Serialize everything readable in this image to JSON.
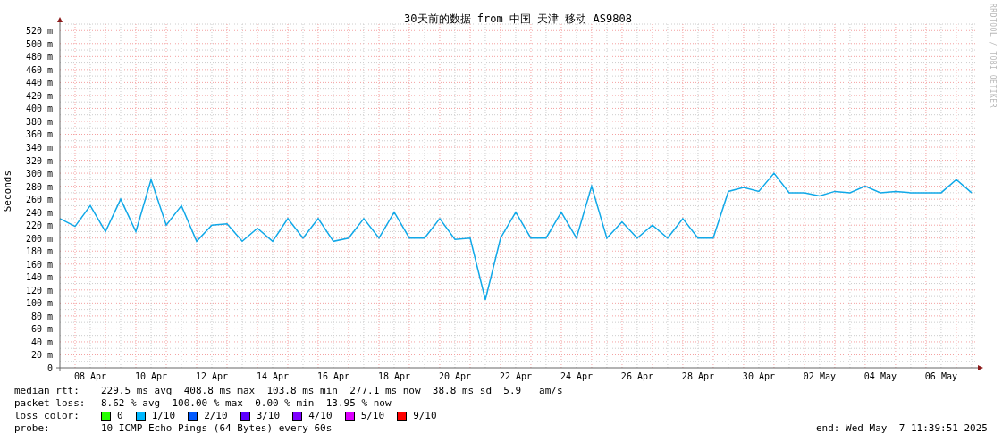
{
  "graph": {
    "credit": "RRDTOOL / TOBI OETIKER",
    "chart_data": {
      "type": "line",
      "title": "30天前的数据 from 中国 天津 移动 AS9808",
      "ylabel": "Seconds",
      "ylim": [
        0,
        530
      ],
      "grid": true,
      "yticks": [
        {
          "value": 0,
          "label": "0"
        },
        {
          "value": 20,
          "label": "20 m"
        },
        {
          "value": 40,
          "label": "40 m"
        },
        {
          "value": 60,
          "label": "60 m"
        },
        {
          "value": 80,
          "label": "80 m"
        },
        {
          "value": 100,
          "label": "100 m"
        },
        {
          "value": 120,
          "label": "120 m"
        },
        {
          "value": 140,
          "label": "140 m"
        },
        {
          "value": 160,
          "label": "160 m"
        },
        {
          "value": 180,
          "label": "180 m"
        },
        {
          "value": 200,
          "label": "200 m"
        },
        {
          "value": 220,
          "label": "220 m"
        },
        {
          "value": 240,
          "label": "240 m"
        },
        {
          "value": 260,
          "label": "260 m"
        },
        {
          "value": 280,
          "label": "280 m"
        },
        {
          "value": 300,
          "label": "300 m"
        },
        {
          "value": 320,
          "label": "320 m"
        },
        {
          "value": 340,
          "label": "340 m"
        },
        {
          "value": 360,
          "label": "360 m"
        },
        {
          "value": 380,
          "label": "380 m"
        },
        {
          "value": 400,
          "label": "400 m"
        },
        {
          "value": 420,
          "label": "420 m"
        },
        {
          "value": 440,
          "label": "440 m"
        },
        {
          "value": 460,
          "label": "460 m"
        },
        {
          "value": 480,
          "label": "480 m"
        },
        {
          "value": 500,
          "label": "500 m"
        },
        {
          "value": 520,
          "label": "520 m"
        }
      ],
      "categories": [
        null,
        null,
        "08 Apr",
        null,
        null,
        null,
        "10 Apr",
        null,
        null,
        null,
        "12 Apr",
        null,
        null,
        null,
        "14 Apr",
        null,
        null,
        null,
        "16 Apr",
        null,
        null,
        null,
        "18 Apr",
        null,
        null,
        null,
        "20 Apr",
        null,
        null,
        null,
        "22 Apr",
        null,
        null,
        null,
        "24 Apr",
        null,
        null,
        null,
        "26 Apr",
        null,
        null,
        null,
        "28 Apr",
        null,
        null,
        null,
        "30 Apr",
        null,
        null,
        null,
        "02 May",
        null,
        null,
        null,
        "04 May",
        null,
        null,
        null,
        "06 May",
        null,
        null
      ],
      "series": [
        {
          "color": "#10a8e8",
          "values": [
            230,
            218,
            250,
            210,
            260,
            210,
            290,
            220,
            250,
            195,
            220,
            222,
            195,
            215,
            195,
            230,
            200,
            230,
            195,
            200,
            230,
            200,
            240,
            200,
            200,
            230,
            198,
            200,
            105,
            200,
            240,
            200,
            200,
            240,
            200,
            280,
            200,
            225,
            200,
            220,
            200,
            230,
            200,
            200,
            272,
            278,
            272,
            300,
            270,
            270,
            265,
            272,
            270,
            280,
            270,
            272,
            270,
            270,
            270,
            290,
            270
          ]
        }
      ]
    }
  },
  "legend": {
    "median_rtt": {
      "label": "median rtt:",
      "text": "229.5 ms avg  408.8 ms max  103.8 ms min  277.1 ms now  38.8 ms sd  5.9   am/s"
    },
    "packet_loss": {
      "label": "packet loss:",
      "text": "8.62 % avg  100.00 % max  0.00 % min  13.95 % now"
    },
    "loss_color": {
      "label": "loss color:",
      "items": [
        {
          "label": "0",
          "color": "#26ff00"
        },
        {
          "label": "1/10",
          "color": "#00b8ff"
        },
        {
          "label": "2/10",
          "color": "#0059ff"
        },
        {
          "label": "3/10",
          "color": "#5e00ff"
        },
        {
          "label": "4/10",
          "color": "#7e00ff"
        },
        {
          "label": "5/10",
          "color": "#dd00ff"
        },
        {
          "label": "9/10",
          "color": "#ff0000"
        }
      ]
    },
    "probe": {
      "label": "probe:",
      "text": "10 ICMP Echo Pings (64 Bytes) every 60s"
    },
    "end": "end: Wed May  7 11:39:51 2025"
  }
}
